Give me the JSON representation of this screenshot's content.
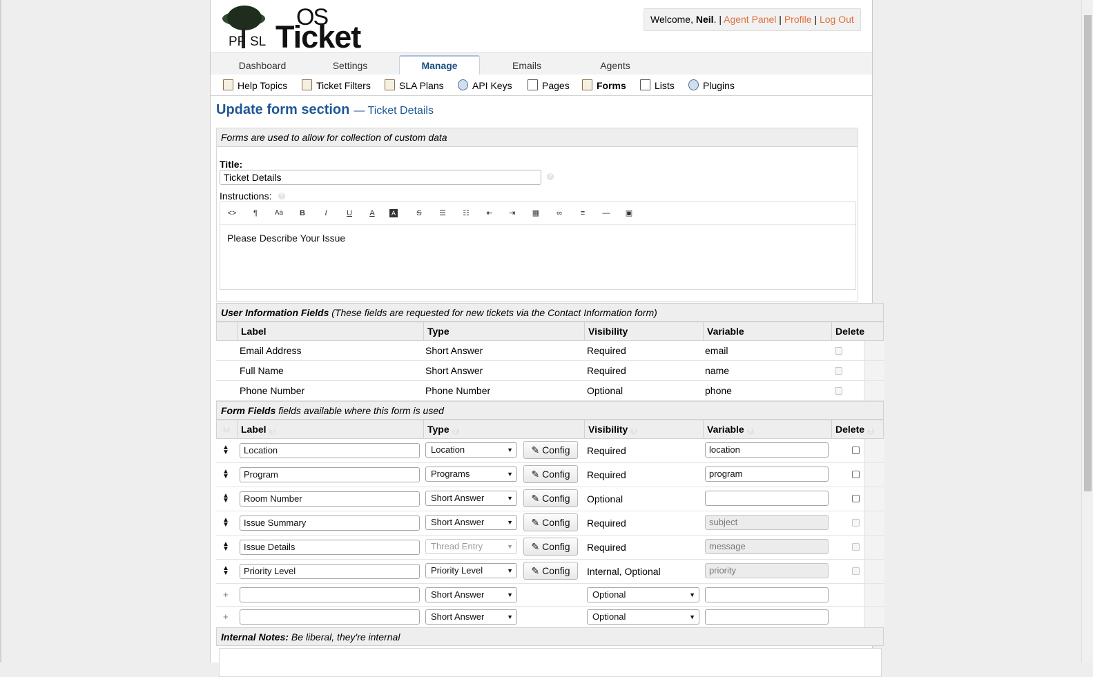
{
  "header": {
    "logo": {
      "top": "OS",
      "main": "Ticket",
      "left": "PF",
      "right": "SL"
    },
    "welcome_prefix": "Welcome, ",
    "user_name": "Neil",
    "welcome_suffix": ".",
    "sep": "|",
    "links": {
      "agent_panel": "Agent Panel",
      "profile": "Profile",
      "logout": "Log Out"
    }
  },
  "nav": {
    "tabs": [
      {
        "label": "Dashboard"
      },
      {
        "label": "Settings"
      },
      {
        "label": "Manage",
        "active": true
      },
      {
        "label": "Emails"
      },
      {
        "label": "Agents"
      }
    ]
  },
  "subnav": {
    "items": [
      {
        "label": "Help Topics",
        "icon": "help-topics-icon"
      },
      {
        "label": "Ticket Filters",
        "icon": "ticket-filters-icon"
      },
      {
        "label": "SLA Plans",
        "icon": "sla-plans-icon"
      },
      {
        "label": "API Keys",
        "icon": "api-keys-icon"
      },
      {
        "label": "Pages",
        "icon": "pages-icon"
      },
      {
        "label": "Forms",
        "icon": "forms-icon",
        "active": true
      },
      {
        "label": "Lists",
        "icon": "lists-icon"
      },
      {
        "label": "Plugins",
        "icon": "plugins-icon"
      }
    ]
  },
  "page": {
    "title": "Update form section",
    "subtitle": "— Ticket Details"
  },
  "form": {
    "intro": "Forms are used to allow for collection of custom data",
    "title_label": "Title:",
    "title_value": "Ticket Details",
    "instructions_label": "Instructions:",
    "instructions_text": "Please Describe Your Issue",
    "toolbar": [
      "<>",
      "¶",
      "Aa",
      "B",
      "I",
      "U",
      "A",
      "A",
      "S",
      "list",
      "olist",
      "outdent",
      "indent",
      "table",
      "link",
      "align",
      "hr",
      "video"
    ]
  },
  "user_info": {
    "heading_bold": "User Information Fields",
    "heading_note": "(These fields are requested for new tickets via the Contact Information form)",
    "columns": [
      "Label",
      "Type",
      "Visibility",
      "Variable",
      "Delete"
    ],
    "rows": [
      {
        "label": "Email Address",
        "type": "Short Answer",
        "visibility": "Required",
        "variable": "email"
      },
      {
        "label": "Full Name",
        "type": "Short Answer",
        "visibility": "Required",
        "variable": "name"
      },
      {
        "label": "Phone Number",
        "type": "Phone Number",
        "visibility": "Optional",
        "variable": "phone"
      }
    ]
  },
  "form_fields": {
    "heading_bold": "Form Fields",
    "heading_note": "fields available where this form is used",
    "columns": [
      "Label",
      "Type",
      "Visibility",
      "Variable",
      "Delete"
    ],
    "config_label": "Config",
    "rows": [
      {
        "label": "Location",
        "type": "Location",
        "visibility": "Required",
        "variable": "location",
        "variable_readonly": false,
        "type_disabled": false,
        "delete_enabled": true
      },
      {
        "label": "Program",
        "type": "Programs",
        "visibility": "Required",
        "variable": "program",
        "variable_readonly": false,
        "type_disabled": false,
        "delete_enabled": true
      },
      {
        "label": "Room Number",
        "type": "Short Answer",
        "visibility": "Optional",
        "variable": "",
        "variable_readonly": false,
        "type_disabled": false,
        "delete_enabled": true
      },
      {
        "label": "Issue Summary",
        "type": "Short Answer",
        "visibility": "Required",
        "variable": "subject",
        "variable_readonly": true,
        "type_disabled": false,
        "delete_enabled": false
      },
      {
        "label": "Issue Details",
        "type": "Thread Entry",
        "visibility": "Required",
        "variable": "message",
        "variable_readonly": true,
        "type_disabled": true,
        "delete_enabled": false
      },
      {
        "label": "Priority Level",
        "type": "Priority Level",
        "visibility": "Internal, Optional",
        "variable": "priority",
        "variable_readonly": true,
        "type_disabled": false,
        "delete_enabled": false
      }
    ],
    "new_rows": [
      {
        "plus": "+",
        "label": "",
        "type": "Short Answer",
        "visibility": "Optional",
        "variable": ""
      },
      {
        "plus": "+",
        "label": "",
        "type": "Short Answer",
        "visibility": "Optional",
        "variable": ""
      }
    ]
  },
  "notes": {
    "heading_bold": "Internal Notes:",
    "heading_note": "Be liberal, they're internal"
  }
}
